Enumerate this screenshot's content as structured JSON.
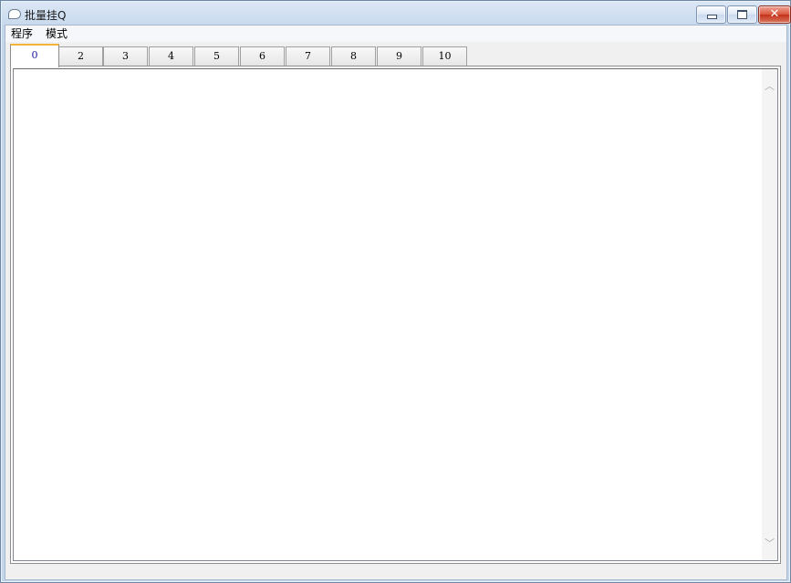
{
  "window": {
    "title": "批量挂Q",
    "close_glyph": "✕"
  },
  "menu": {
    "items": [
      "程序",
      "模式"
    ]
  },
  "tabs": [
    "0",
    "2",
    "3",
    "4",
    "5",
    "6",
    "7",
    "8",
    "9",
    "10"
  ],
  "active_tab": "0",
  "scrollbar": {
    "up_glyph": "︿",
    "down_glyph": "﹀"
  },
  "colors": {
    "active_tab_accent": "#f2b53a",
    "close_button": "#c4321b"
  }
}
